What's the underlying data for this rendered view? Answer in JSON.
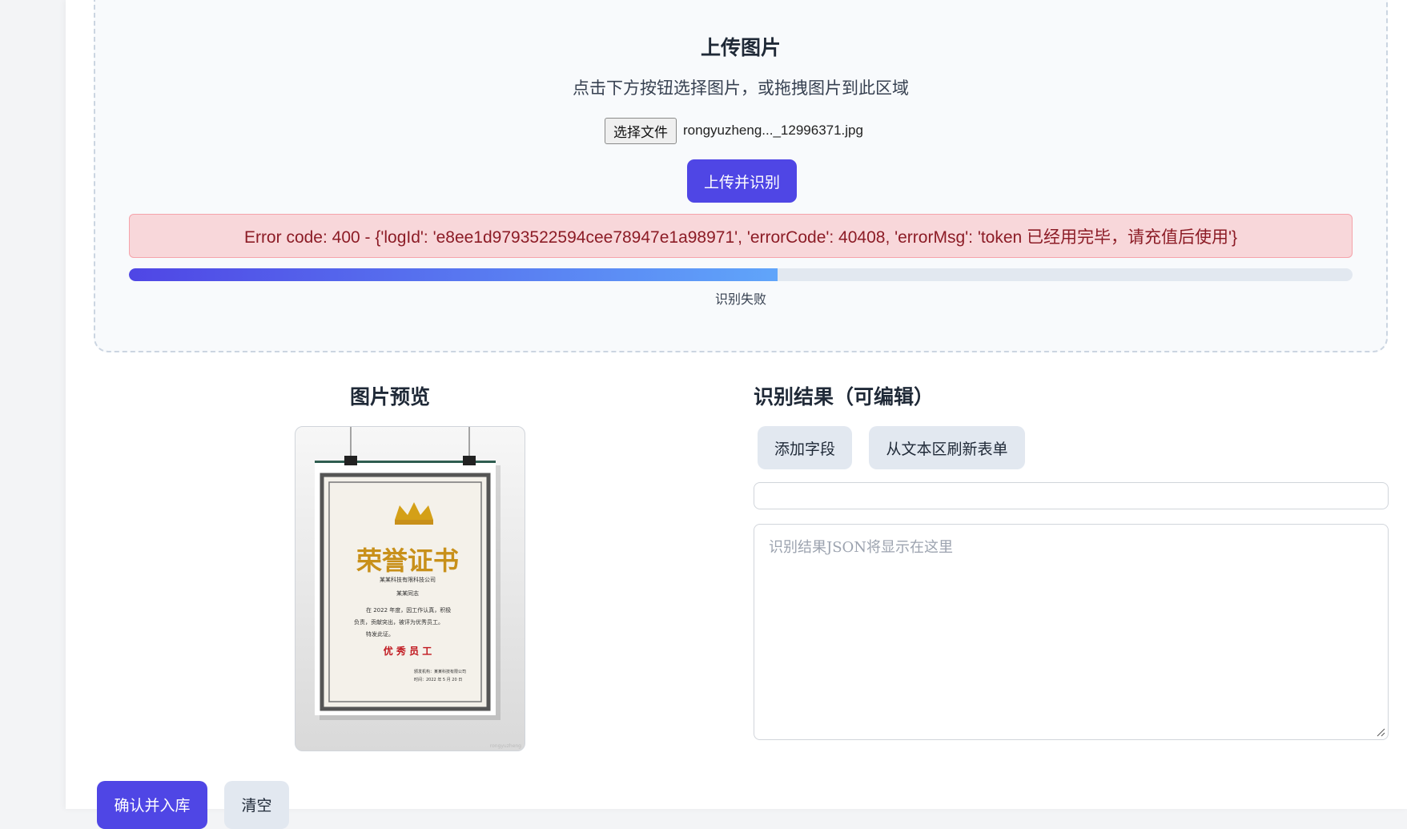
{
  "upload": {
    "title": "上传图片",
    "hint": "点击下方按钮选择图片，或拖拽图片到此区域",
    "choose_file_label": "选择文件",
    "file_name": "rongyuzheng..._12996371.jpg",
    "submit_label": "上传并识别"
  },
  "error": {
    "message": "Error code: 400 - {'logId': 'e8ee1d9793522594cee78947e1a98971', 'errorCode': 40408, 'errorMsg': 'token 已经用完毕，请充值后使用'}"
  },
  "progress": {
    "percent": 53,
    "status": "识别失败"
  },
  "preview": {
    "title": "图片预览",
    "certificate": {
      "heading": "荣誉证书",
      "company": "某某科技有限科技公司",
      "recipient": "某某同志",
      "body_line1": "在 2022 年度，因工作认真，积极",
      "body_line2": "负责，贡献突出，被评为优秀员工。",
      "body_line3": "特发此证。",
      "award": "优 秀 员 工",
      "issuer": "颁发机构：某某科技有限公司",
      "date": "时间：2022 年 5 月 20 日",
      "watermark": "rongyuzheng"
    }
  },
  "result": {
    "title": "识别结果（可编辑）",
    "add_field_label": "添加字段",
    "refresh_label": "从文本区刷新表单",
    "textarea_placeholder": "识别结果JSON将显示在这里"
  },
  "actions": {
    "confirm_label": "确认并入库",
    "clear_label": "清空"
  },
  "colors": {
    "primary": "#4f46e5",
    "error_bg": "#f8d7da",
    "error_text": "#8c1c26"
  }
}
